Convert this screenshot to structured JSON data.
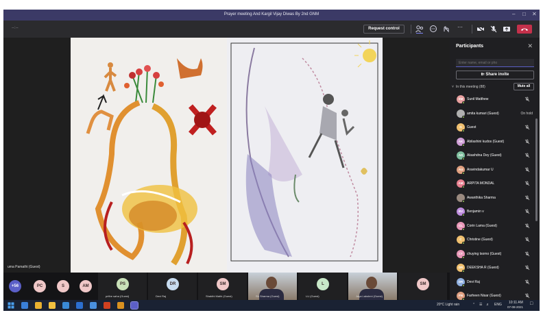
{
  "window": {
    "title": "Prayer meeting And Kargil Vijay Diwas By 2nd GNM"
  },
  "toolbar": {
    "request_control_label": "Request control",
    "timer": "--:--"
  },
  "stage": {
    "presenter_name": "uma Pamathi (Guest)"
  },
  "panel": {
    "title": "Participants",
    "search_placeholder": "Enter name, email or pho",
    "share_invite_label": "Share invite",
    "section_label": "In this meeting (88)",
    "mute_all_label": "Mute all",
    "participants": [
      {
        "initials": "SM",
        "name": "Sunil Matthew",
        "status": "",
        "color": "#e8a0a0"
      },
      {
        "initials": "",
        "name": "amita kumari (Guest)",
        "status": "On hold",
        "color": "#b0b0b0"
      },
      {
        "initials": "G",
        "name": "Guest",
        "status": "",
        "color": "#f0c070"
      },
      {
        "initials": "AK",
        "name": "Abilashini kudos (Guest)",
        "status": "",
        "color": "#d0a0d8"
      },
      {
        "initials": "AD",
        "name": "Akashdna Dey (Guest)",
        "status": "",
        "color": "#80c0a0"
      },
      {
        "initials": "AU",
        "name": "Aravindakumar U",
        "status": "",
        "color": "#e0a080"
      },
      {
        "initials": "AM",
        "name": "ARPITA MONDAL",
        "status": "",
        "color": "#e88090"
      },
      {
        "initials": "",
        "name": "Awanthika Sharma",
        "status": "",
        "color": "#9a8a80"
      },
      {
        "initials": "BV",
        "name": "Benjamin v",
        "status": "",
        "color": "#c090e0"
      },
      {
        "initials": "CL",
        "name": "Corin Lama (Guest)",
        "status": "",
        "color": "#e898b8"
      },
      {
        "initials": "C",
        "name": "Christine (Guest)",
        "status": "",
        "color": "#f0c070"
      },
      {
        "initials": "CT",
        "name": "chuying tsomo (Guest)",
        "status": "",
        "color": "#e898b8"
      },
      {
        "initials": "DR",
        "name": "DEEKSHA R (Guest)",
        "status": "",
        "color": "#f0c070"
      },
      {
        "initials": "DR",
        "name": "Devi Raj",
        "status": "",
        "color": "#90b0e0"
      },
      {
        "initials": "FN",
        "name": "Farheen Nisar (Guest)",
        "status": "",
        "color": "#e0a080"
      }
    ]
  },
  "gallery": {
    "overflow_count": "+56",
    "small_avatars": [
      {
        "initials": "PC",
        "color": "#f0c8c8"
      },
      {
        "initials": "S",
        "color": "#f0c8c8"
      },
      {
        "initials": "AM",
        "color": "#f0c8c8"
      }
    ],
    "tiles": [
      {
        "initials": "PS",
        "name": "prithe saha (Guest)",
        "color": "#c8e0b8",
        "kind": "avatar"
      },
      {
        "initials": "DR",
        "name": "Devi Raj",
        "color": "#c8dcf0",
        "kind": "avatar"
      },
      {
        "initials": "SM",
        "name": "Shakthi Mathi (Guest)",
        "color": "#f0c8c8",
        "kind": "avatar"
      },
      {
        "initials": "",
        "name": "Sh Sharma (Guest)",
        "color": "",
        "kind": "video"
      },
      {
        "initials": "L",
        "name": "LU (Guest)",
        "color": "#c8e8c8",
        "kind": "avatar"
      },
      {
        "initials": "",
        "name": "Jaya Lakshmi (Guest)",
        "color": "",
        "kind": "video"
      },
      {
        "initials": "SM",
        "name": "",
        "color": "#f0c8c8",
        "kind": "avatar"
      }
    ]
  },
  "taskbar": {
    "weather": "20°C  Light rain",
    "lang": "ENG",
    "time": "10:11 AM",
    "date": "07-08-2021"
  },
  "colors": {
    "title_bar": "#3b3a66",
    "toolbar": "#2b2b2e",
    "leave": "#c4314b",
    "accent": "#5b5fc7",
    "online": "#92c353"
  }
}
